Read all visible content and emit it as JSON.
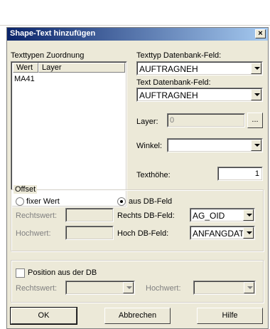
{
  "dialog": {
    "title": "Shape-Text hinzufügen",
    "close_glyph": "×"
  },
  "texttypen": {
    "label": "Texttypen Zuordnung",
    "columns": [
      "Wert",
      "Layer"
    ],
    "rows": [
      {
        "wert": "MA41",
        "layer": ""
      }
    ]
  },
  "texttyp_db": {
    "label": "Texttyp Datenbank-Feld:",
    "value": "AUFTRAGNEH"
  },
  "text_db": {
    "label": "Text Datenbank-Feld:",
    "value": "AUFTRAGNEH"
  },
  "layer": {
    "label": "Layer:",
    "value": "0",
    "browse_label": "..."
  },
  "winkel": {
    "label": "Winkel:",
    "value": ""
  },
  "texthoehe": {
    "label": "Texthöhe:",
    "value": "1"
  },
  "offset": {
    "title": "Offset",
    "fixer_wert": "fixer Wert",
    "aus_db": "aus DB-Feld",
    "rechtswert_label": "Rechtswert:",
    "hochwert_label": "Hochwert:",
    "rechts_db_label": "Rechts DB-Feld:",
    "rechts_db_value": "AG_OID",
    "hoch_db_label": "Hoch DB-Feld:",
    "hoch_db_value": "ANFANGDATU",
    "selected": "aus DB-Feld"
  },
  "position": {
    "checkbox_label": "Position aus der DB",
    "rechtswert_label": "Rechtswert:",
    "hochwert_label": "Hochwert:",
    "checked": false
  },
  "buttons": {
    "ok": "OK",
    "cancel": "Abbrechen",
    "help": "Hilfe"
  }
}
